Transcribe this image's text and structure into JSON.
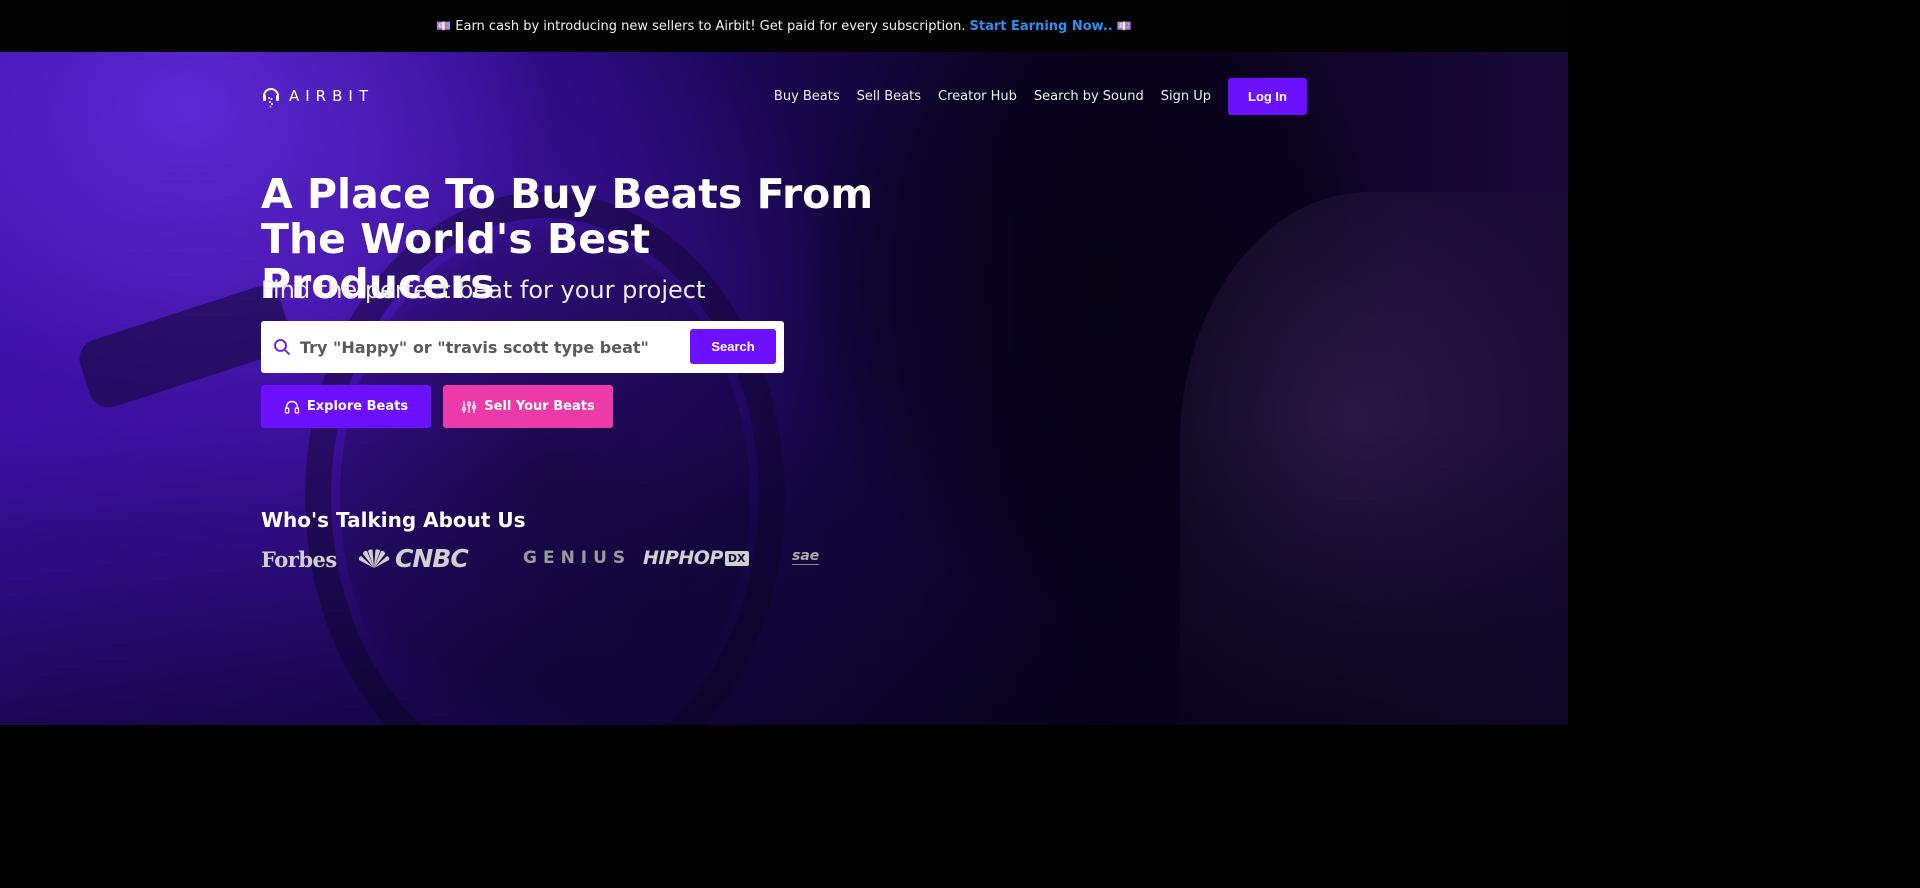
{
  "promo": {
    "emoji_left": "💷",
    "text": "Earn cash by introducing new sellers to Airbit! Get paid for every subscription.",
    "link_label": "Start Earning Now..",
    "emoji_right": "💷"
  },
  "brand": {
    "name": "AIRBIT"
  },
  "nav": {
    "items": [
      {
        "label": "Buy Beats"
      },
      {
        "label": "Sell Beats"
      },
      {
        "label": "Creator Hub"
      },
      {
        "label": "Search by Sound"
      },
      {
        "label": "Sign Up"
      }
    ],
    "login_label": "Log In"
  },
  "hero": {
    "headline_line1": "A Place To Buy Beats From",
    "headline_line2": "The World's Best Producers",
    "subheadline": "Find the perfect beat for your project"
  },
  "search": {
    "placeholder": "Try \"Happy\" or \"travis scott type beat\"",
    "value": "",
    "button_label": "Search"
  },
  "cta": {
    "explore_label": "Explore Beats",
    "explore_icon": "headphones-icon",
    "sell_label": "Sell Your Beats",
    "sell_icon": "sliders-icon"
  },
  "press": {
    "title": "Who's Talking About Us",
    "logos": [
      {
        "name": "Forbes"
      },
      {
        "name": "CNBC"
      },
      {
        "name": "GENIUS"
      },
      {
        "name": "HIPHOP",
        "suffix": "DX"
      },
      {
        "name": "sae"
      }
    ]
  },
  "colors": {
    "accent": "#6c10ff",
    "sell_accent": "#ec3aa8",
    "link": "#2f8df0",
    "promo_bg": "#030303"
  }
}
